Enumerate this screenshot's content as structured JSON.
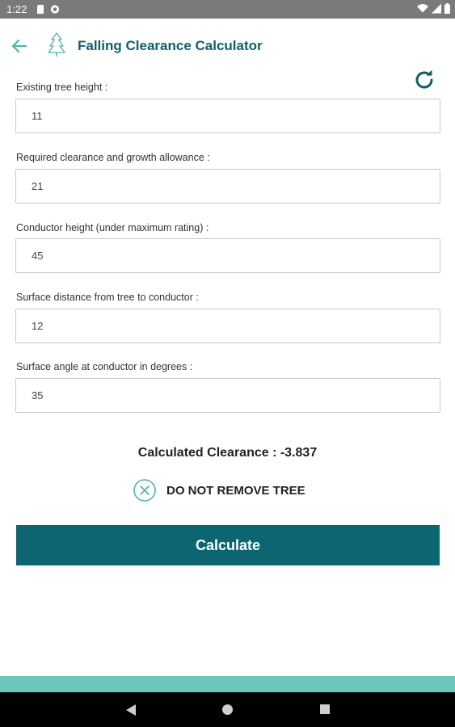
{
  "status_bar": {
    "time": "1:22"
  },
  "app_bar": {
    "title": "Falling Clearance Calculator"
  },
  "fields": [
    {
      "label": "Existing tree height :",
      "value": "11"
    },
    {
      "label": "Required clearance and growth allowance :",
      "value": "21"
    },
    {
      "label": "Conductor height (under maximum rating) :",
      "value": "45"
    },
    {
      "label": "Surface distance from tree to conductor :",
      "value": "12"
    },
    {
      "label": "Surface angle at conductor in degrees :",
      "value": "35"
    }
  ],
  "result": {
    "clearance_text": "Calculated Clearance : -3.837",
    "decision": "DO NOT REMOVE TREE"
  },
  "calculate_button": {
    "label": "Calculate"
  },
  "colors": {
    "primary": "#0c6570",
    "title": "#0f5f6b",
    "accent": "#4fb5a8",
    "bottom_strip": "#6ec6bb"
  },
  "icons": {
    "back": "arrow-left-icon",
    "app": "pine-tree-icon",
    "refresh": "refresh-icon",
    "decision": "x-circle-icon"
  }
}
